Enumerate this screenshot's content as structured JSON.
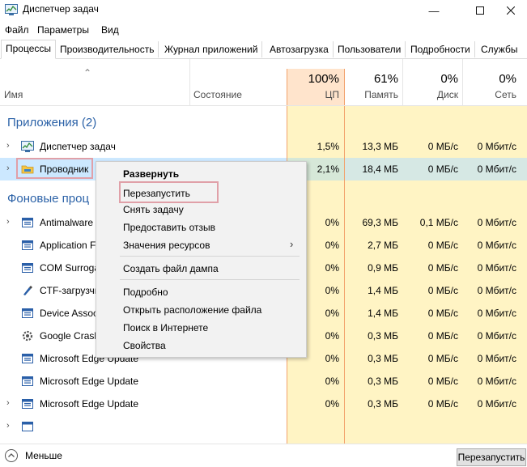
{
  "window": {
    "title": "Диспетчер задач"
  },
  "menu": [
    "Файл",
    "Параметры",
    "Вид"
  ],
  "tabs": [
    "Процессы",
    "Производительность",
    "Журнал приложений",
    "Автозагрузка",
    "Пользователи",
    "Подробности",
    "Службы"
  ],
  "columns": {
    "name": "Имя",
    "status": "Состояние",
    "cpu": {
      "pct": "100%",
      "label": "ЦП"
    },
    "memory": {
      "pct": "61%",
      "label": "Память"
    },
    "disk": {
      "pct": "0%",
      "label": "Диск"
    },
    "network": {
      "pct": "0%",
      "label": "Сеть"
    }
  },
  "groups": {
    "apps": "Приложения (2)",
    "background": "Фоновые проц"
  },
  "rows": [
    {
      "name": "Диспетчер задач",
      "cpu": "1,5%",
      "mem": "13,3 МБ",
      "disk": "0 МБ/с",
      "net": "0 Мбит/с"
    },
    {
      "name": "Проводник",
      "cpu": "2,1%",
      "mem": "18,4 МБ",
      "disk": "0 МБ/с",
      "net": "0 Мбит/с"
    },
    {
      "name": "Antimalware",
      "cpu": "0%",
      "mem": "69,3 МБ",
      "disk": "0,1 МБ/с",
      "net": "0 Мбит/с"
    },
    {
      "name": "Application F",
      "cpu": "0%",
      "mem": "2,7 МБ",
      "disk": "0 МБ/с",
      "net": "0 Мбит/с"
    },
    {
      "name": "COM Surroga",
      "cpu": "0%",
      "mem": "0,9 МБ",
      "disk": "0 МБ/с",
      "net": "0 Мбит/с"
    },
    {
      "name": "CTF-загрузчи",
      "cpu": "0%",
      "mem": "1,4 МБ",
      "disk": "0 МБ/с",
      "net": "0 Мбит/с"
    },
    {
      "name": "Device Assoc",
      "cpu": "0%",
      "mem": "1,4 МБ",
      "disk": "0 МБ/с",
      "net": "0 Мбит/с"
    },
    {
      "name": "Google Crash",
      "cpu": "0%",
      "mem": "0,3 МБ",
      "disk": "0 МБ/с",
      "net": "0 Мбит/с"
    },
    {
      "name": "Microsoft Edge Update",
      "cpu": "0%",
      "mem": "0,3 МБ",
      "disk": "0 МБ/с",
      "net": "0 Мбит/с"
    },
    {
      "name": "Microsoft Edge Update",
      "cpu": "0%",
      "mem": "0,3 МБ",
      "disk": "0 МБ/с",
      "net": "0 Мбит/с"
    },
    {
      "name": "Microsoft Edge Update",
      "cpu": "0%",
      "mem": "0,3 МБ",
      "disk": "0 МБ/с",
      "net": "0 Мбит/с"
    }
  ],
  "context_menu": {
    "items": [
      "Развернуть",
      "Перезапустить",
      "Снять задачу",
      "Предоставить отзыв",
      "Значения ресурсов",
      "Создать файл дампа",
      "Подробно",
      "Открыть расположение файла",
      "Поиск в Интернете",
      "Свойства"
    ]
  },
  "footer": {
    "less": "Меньше",
    "restart": "Перезапустить"
  },
  "colors": {
    "accent": "#2d63a8",
    "cpu_header": "#ffe4cc",
    "cell_bg": "#fff4c4",
    "highlight_box": "#e0a0a8",
    "selected_row": "#cce8ff"
  }
}
